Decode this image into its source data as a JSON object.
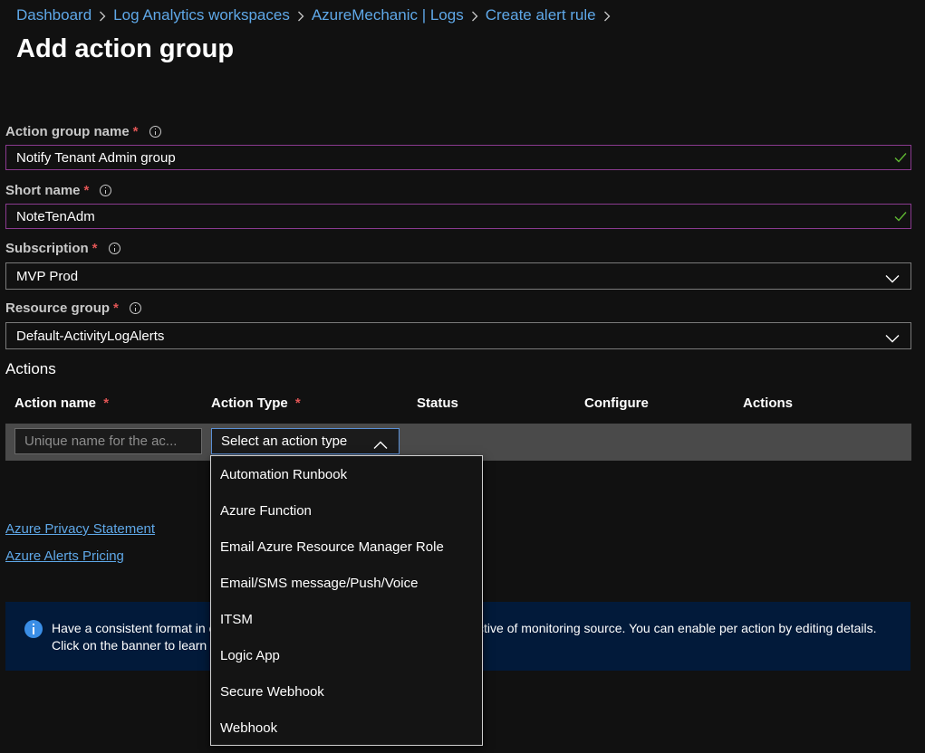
{
  "breadcrumb": [
    "Dashboard",
    "Log Analytics workspaces",
    "AzureMechanic | Logs",
    "Create alert rule"
  ],
  "page_title": "Add action group",
  "fields": {
    "action_group_name": {
      "label": "Action group name",
      "required_mark": "*",
      "value": "Notify Tenant Admin group"
    },
    "short_name": {
      "label": "Short name",
      "required_mark": "*",
      "value": "NoteTenAdm"
    },
    "subscription": {
      "label": "Subscription",
      "required_mark": "*",
      "value": "MVP Prod"
    },
    "resource_group": {
      "label": "Resource group",
      "required_mark": "*",
      "value": "Default-ActivityLogAlerts"
    }
  },
  "actions": {
    "title": "Actions",
    "columns": {
      "action_name": "Action name",
      "action_name_required": "*",
      "action_type": "Action Type",
      "action_type_required": "*",
      "status": "Status",
      "configure": "Configure",
      "actions": "Actions"
    },
    "row": {
      "name_placeholder": "Unique name for the ac...",
      "type_value": "Select an action type"
    }
  },
  "dropdown_options": [
    "Automation Runbook",
    "Azure Function",
    "Email Azure Resource Manager Role",
    "Email/SMS message/Push/Voice",
    "ITSM",
    "Logic App",
    "Secure Webhook",
    "Webhook"
  ],
  "links": {
    "privacy": "Azure Privacy Statement",
    "pricing": "Azure Alerts Pricing"
  },
  "banner": {
    "text": "Have a consistent format in emails, notifications and other endpoints irrespective of monitoring source. You can enable per action by editing details. Click on the banner to learn more."
  },
  "colors": {
    "background": "#111111",
    "link": "#5fa8e8",
    "required": "#e05555",
    "valid_check": "#5fb832",
    "input_border": "#8a3a8f",
    "banner_bg": "#021a3a"
  },
  "icons": [
    "chevron-right-icon",
    "info-icon",
    "checkmark-icon",
    "chevron-down-icon",
    "chevron-up-icon",
    "info-filled-icon"
  ]
}
